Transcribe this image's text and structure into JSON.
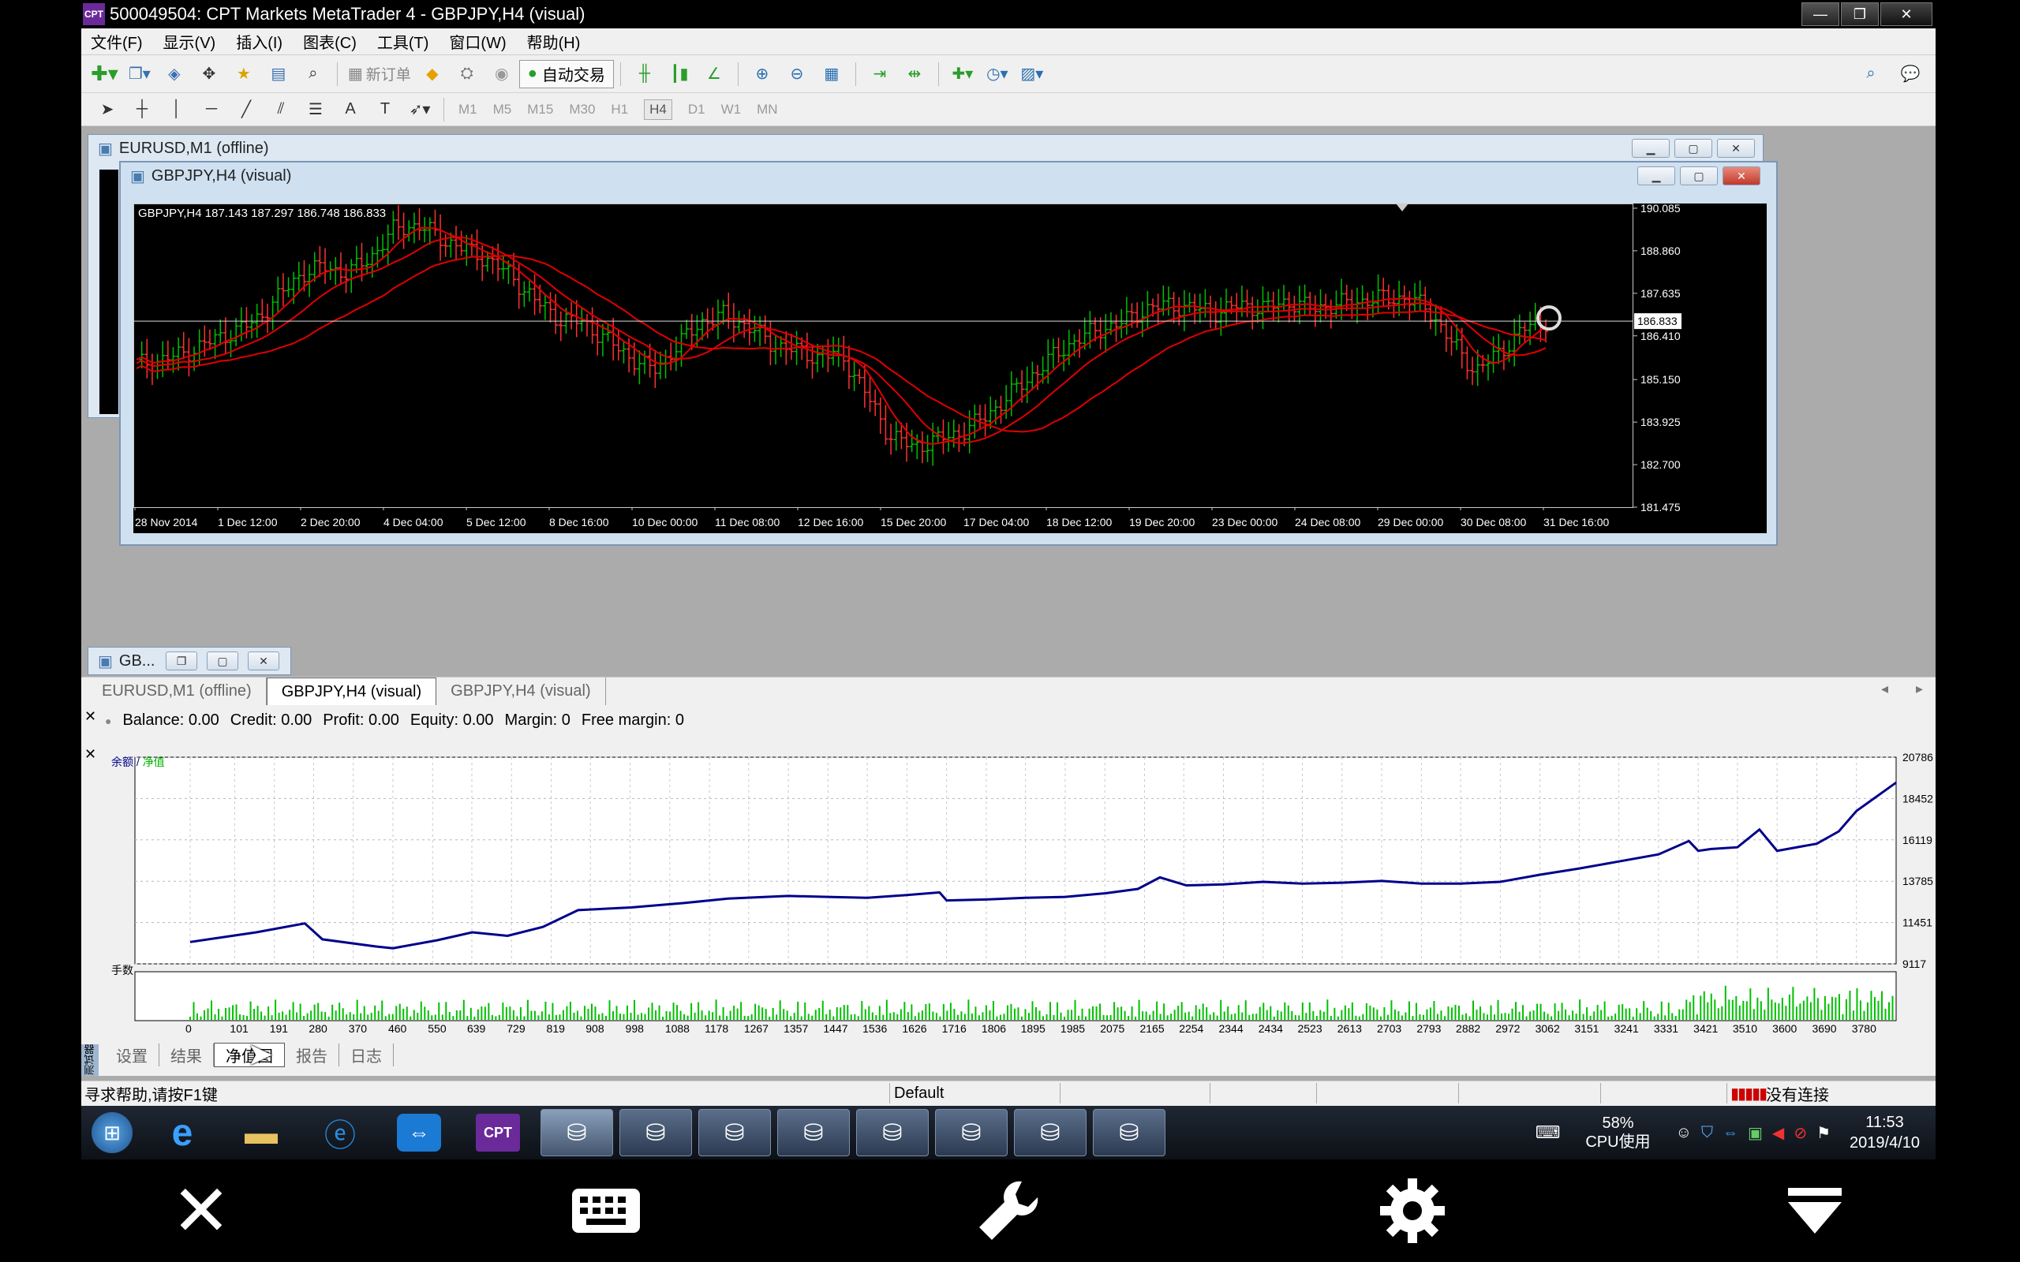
{
  "window": {
    "title": "500049504: CPT Markets MetaTrader 4 - GBPJPY,H4 (visual)",
    "logo_text": "CPT",
    "minimize": "—",
    "restore": "❐",
    "close": "✕"
  },
  "menu": [
    "文件(F)",
    "显示(V)",
    "插入(I)",
    "图表(C)",
    "工具(T)",
    "窗口(W)",
    "帮助(H)"
  ],
  "toolbar": {
    "new_order_label": "新订单",
    "autotrade_label": "自动交易",
    "timeframes": [
      "M1",
      "M5",
      "M15",
      "M30",
      "H1",
      "H4",
      "D1",
      "W1",
      "MN"
    ],
    "active_timeframe": "H4"
  },
  "child_windows": {
    "eurusd_title": "EURUSD,M1 (offline)",
    "gbpjpy_title": "GBPJPY,H4 (visual)",
    "minimized_title": "GB..."
  },
  "chart": {
    "info_line": "GBPJPY,H4  187.143 187.297 186.748 186.833",
    "current_price": "186.833",
    "price_labels": [
      "190.085",
      "188.860",
      "187.635",
      "186.410",
      "185.150",
      "183.925",
      "182.700",
      "181.475"
    ],
    "date_labels": [
      "28 Nov 2014",
      "1 Dec 12:00",
      "2 Dec 20:00",
      "4 Dec 04:00",
      "5 Dec 12:00",
      "8 Dec 16:00",
      "10 Dec 00:00",
      "11 Dec 08:00",
      "12 Dec 16:00",
      "15 Dec 20:00",
      "17 Dec 04:00",
      "18 Dec 12:00",
      "19 Dec 20:00",
      "23 Dec 00:00",
      "24 Dec 08:00",
      "29 Dec 00:00",
      "30 Dec 08:00",
      "31 Dec 16:00"
    ],
    "bull_color": "#00c000",
    "bear_color": "#ff3030",
    "ma_color": "#e00000"
  },
  "chart_tabs": [
    "EURUSD,M1 (offline)",
    "GBPJPY,H4 (visual)",
    "GBPJPY,H4 (visual)"
  ],
  "active_chart_tab": 1,
  "tester": {
    "balance_items": [
      "Balance: 0.00",
      "Credit: 0.00",
      "Profit: 0.00",
      "Equity: 0.00",
      "Margin: 0",
      "Free margin: 0"
    ],
    "legend_balance": "余额",
    "legend_sep": " / ",
    "legend_equity": "净值",
    "lots_label": "手数",
    "side_label": "测试器",
    "subtabs": [
      "设置",
      "结果",
      "净值图",
      "报告",
      "日志"
    ],
    "active_subtab": 2
  },
  "chart_data": {
    "type": "line",
    "title": "",
    "y_ticks": [
      "20786",
      "18452",
      "16119",
      "13785",
      "11451",
      "9117"
    ],
    "ylim": [
      9117,
      20786
    ],
    "x_ticks": [
      "0",
      "101",
      "191",
      "280",
      "370",
      "460",
      "550",
      "639",
      "729",
      "819",
      "908",
      "998",
      "1088",
      "1178",
      "1267",
      "1357",
      "1447",
      "1536",
      "1626",
      "1716",
      "1806",
      "1895",
      "1985",
      "2075",
      "2165",
      "2254",
      "2344",
      "2434",
      "2523",
      "2613",
      "2703",
      "2793",
      "2882",
      "2972",
      "3062",
      "3151",
      "3241",
      "3331",
      "3421",
      "3510",
      "3600",
      "3690",
      "3780"
    ],
    "xlim": [
      0,
      3870
    ],
    "series": [
      {
        "name": "余额",
        "color": "#00008b",
        "x": [
          0,
          150,
          260,
          300,
          420,
          460,
          560,
          640,
          720,
          800,
          880,
          1000,
          1120,
          1220,
          1357,
          1447,
          1536,
          1626,
          1700,
          1716,
          1806,
          1895,
          1985,
          2075,
          2150,
          2200,
          2260,
          2344,
          2434,
          2523,
          2613,
          2703,
          2793,
          2882,
          2972,
          3062,
          3151,
          3241,
          3331,
          3400,
          3421,
          3450,
          3510,
          3560,
          3600,
          3690,
          3740,
          3780,
          3870
        ],
        "y": [
          10350,
          10900,
          11400,
          10500,
          10100,
          10000,
          10450,
          10900,
          10700,
          11200,
          12150,
          12300,
          12550,
          12800,
          12950,
          12900,
          12850,
          13000,
          13150,
          12700,
          12750,
          12850,
          12900,
          13100,
          13350,
          14000,
          13550,
          13600,
          13750,
          13650,
          13700,
          13800,
          13650,
          13650,
          13750,
          14150,
          14500,
          14900,
          15300,
          16050,
          15500,
          15600,
          15700,
          16700,
          15500,
          15900,
          16600,
          17750,
          19350
        ]
      }
    ],
    "bars": {
      "name": "手数",
      "color": "#00c000"
    }
  },
  "statusbar": {
    "help": "寻求帮助,请按F1键",
    "profile": "Default",
    "connection": "没有连接"
  },
  "taskbar": {
    "cpu_percent": "58%",
    "cpu_label": "CPU使用",
    "time": "11:53",
    "date": "2019/4/10"
  }
}
